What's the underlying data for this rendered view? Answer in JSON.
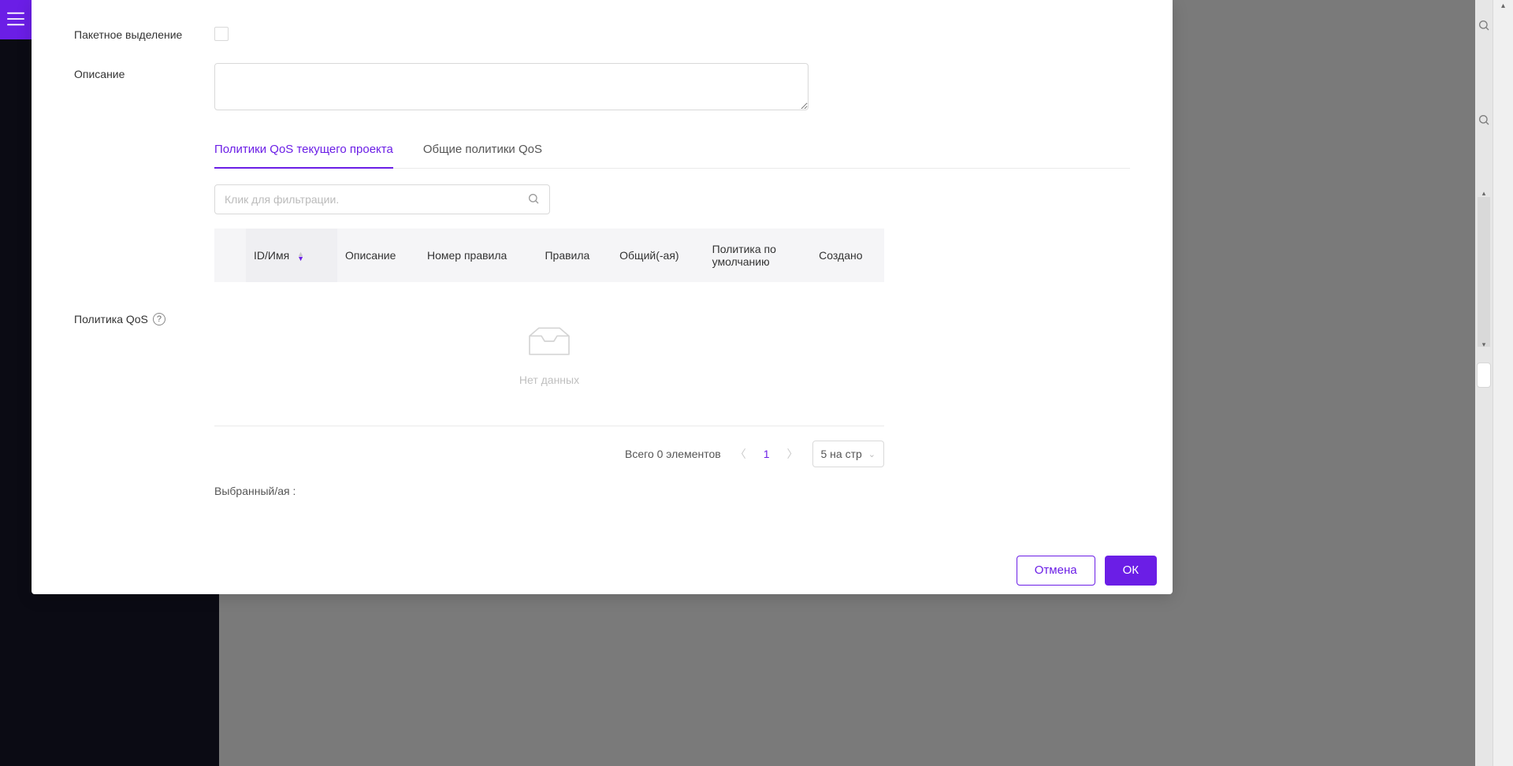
{
  "form": {
    "batch_select_label": "Пакетное выделение",
    "description_label": "Описание",
    "description_value": "",
    "qos_label": "Политика QoS"
  },
  "tabs": {
    "current": "Политики QoS текущего проекта",
    "shared": "Общие политики QoS"
  },
  "filter": {
    "placeholder": "Клик для фильтрации."
  },
  "table": {
    "headers": {
      "id_name": "ID/Имя",
      "description": "Описание",
      "rule_number": "Номер правила",
      "rules": "Правила",
      "shared": "Общий(-ая)",
      "default_policy": "Политика по умолчанию",
      "created": "Создано"
    },
    "empty_text": "Нет данных"
  },
  "pager": {
    "total_text": "Всего 0 элементов",
    "page": "1",
    "page_size_label": "5 на стр"
  },
  "selected_label": "Выбранный/ая :",
  "footer": {
    "cancel": "Отмена",
    "ok": "ОК"
  }
}
